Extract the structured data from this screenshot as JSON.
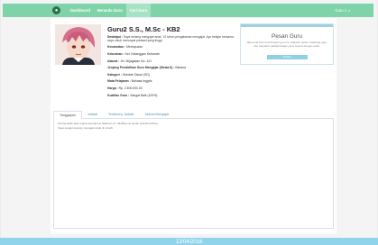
{
  "navbar": {
    "links": [
      "Dashboard",
      "Beranda Guru",
      "Cari Guru"
    ],
    "user_label": "Guru 1",
    "accent": "#7fd3a9"
  },
  "teacher": {
    "name": "Guru2 S.S., M.Sc - KB2",
    "description_label": "Deskripsi :",
    "description": "Saya senang mengajar anak. 10 tahun pengalaman mengajar. Ayo belajar bersama saya untuk mencapai prestasi yang tinggi.",
    "fields": [
      {
        "label": "Kecamatan :",
        "value": "Mertoyudan"
      },
      {
        "label": "Kelurahan :",
        "value": "Kel. Ketanggan Kebumen"
      },
      {
        "label": "Alamat :",
        "value": "Jln. Mijagadan No. 101"
      },
      {
        "label": "Jenjang Pendidikan Guru Mengajar (Strata II) :",
        "value": "Bahasa"
      },
      {
        "label": "Kategori :",
        "value": "Sekolah Dasar (SD)"
      },
      {
        "label": "Mata Pelajaran :",
        "value": "Bahasa Inggris"
      },
      {
        "label": "Harga :",
        "value": "Rp. 2.500.000.00"
      },
      {
        "label": "Kualitas Guru :",
        "value": "Sangat Baik (100%)"
      }
    ]
  },
  "order": {
    "title": "Pesan Guru",
    "text": "Jika anda berminat dengan guru ini, silahkan pesan sekarang juga, dan dapatkan jadwal belajar yang sesuai dengan anda.",
    "button_label": "Pesan",
    "color": "#8fd0e6"
  },
  "tabs": [
    "Tanggapan",
    "Jadwal",
    "Testimony Jadwal",
    "Jadwal Mengajar"
  ],
  "tab_content": [
    "Terima kasih atas respon kemarin di halaman ini. Silahkan isi pesan terlebih dahulu.",
    "Saya sangat senang mengajar anak di rumah."
  ],
  "footer": {
    "text": "12/04/2016"
  }
}
